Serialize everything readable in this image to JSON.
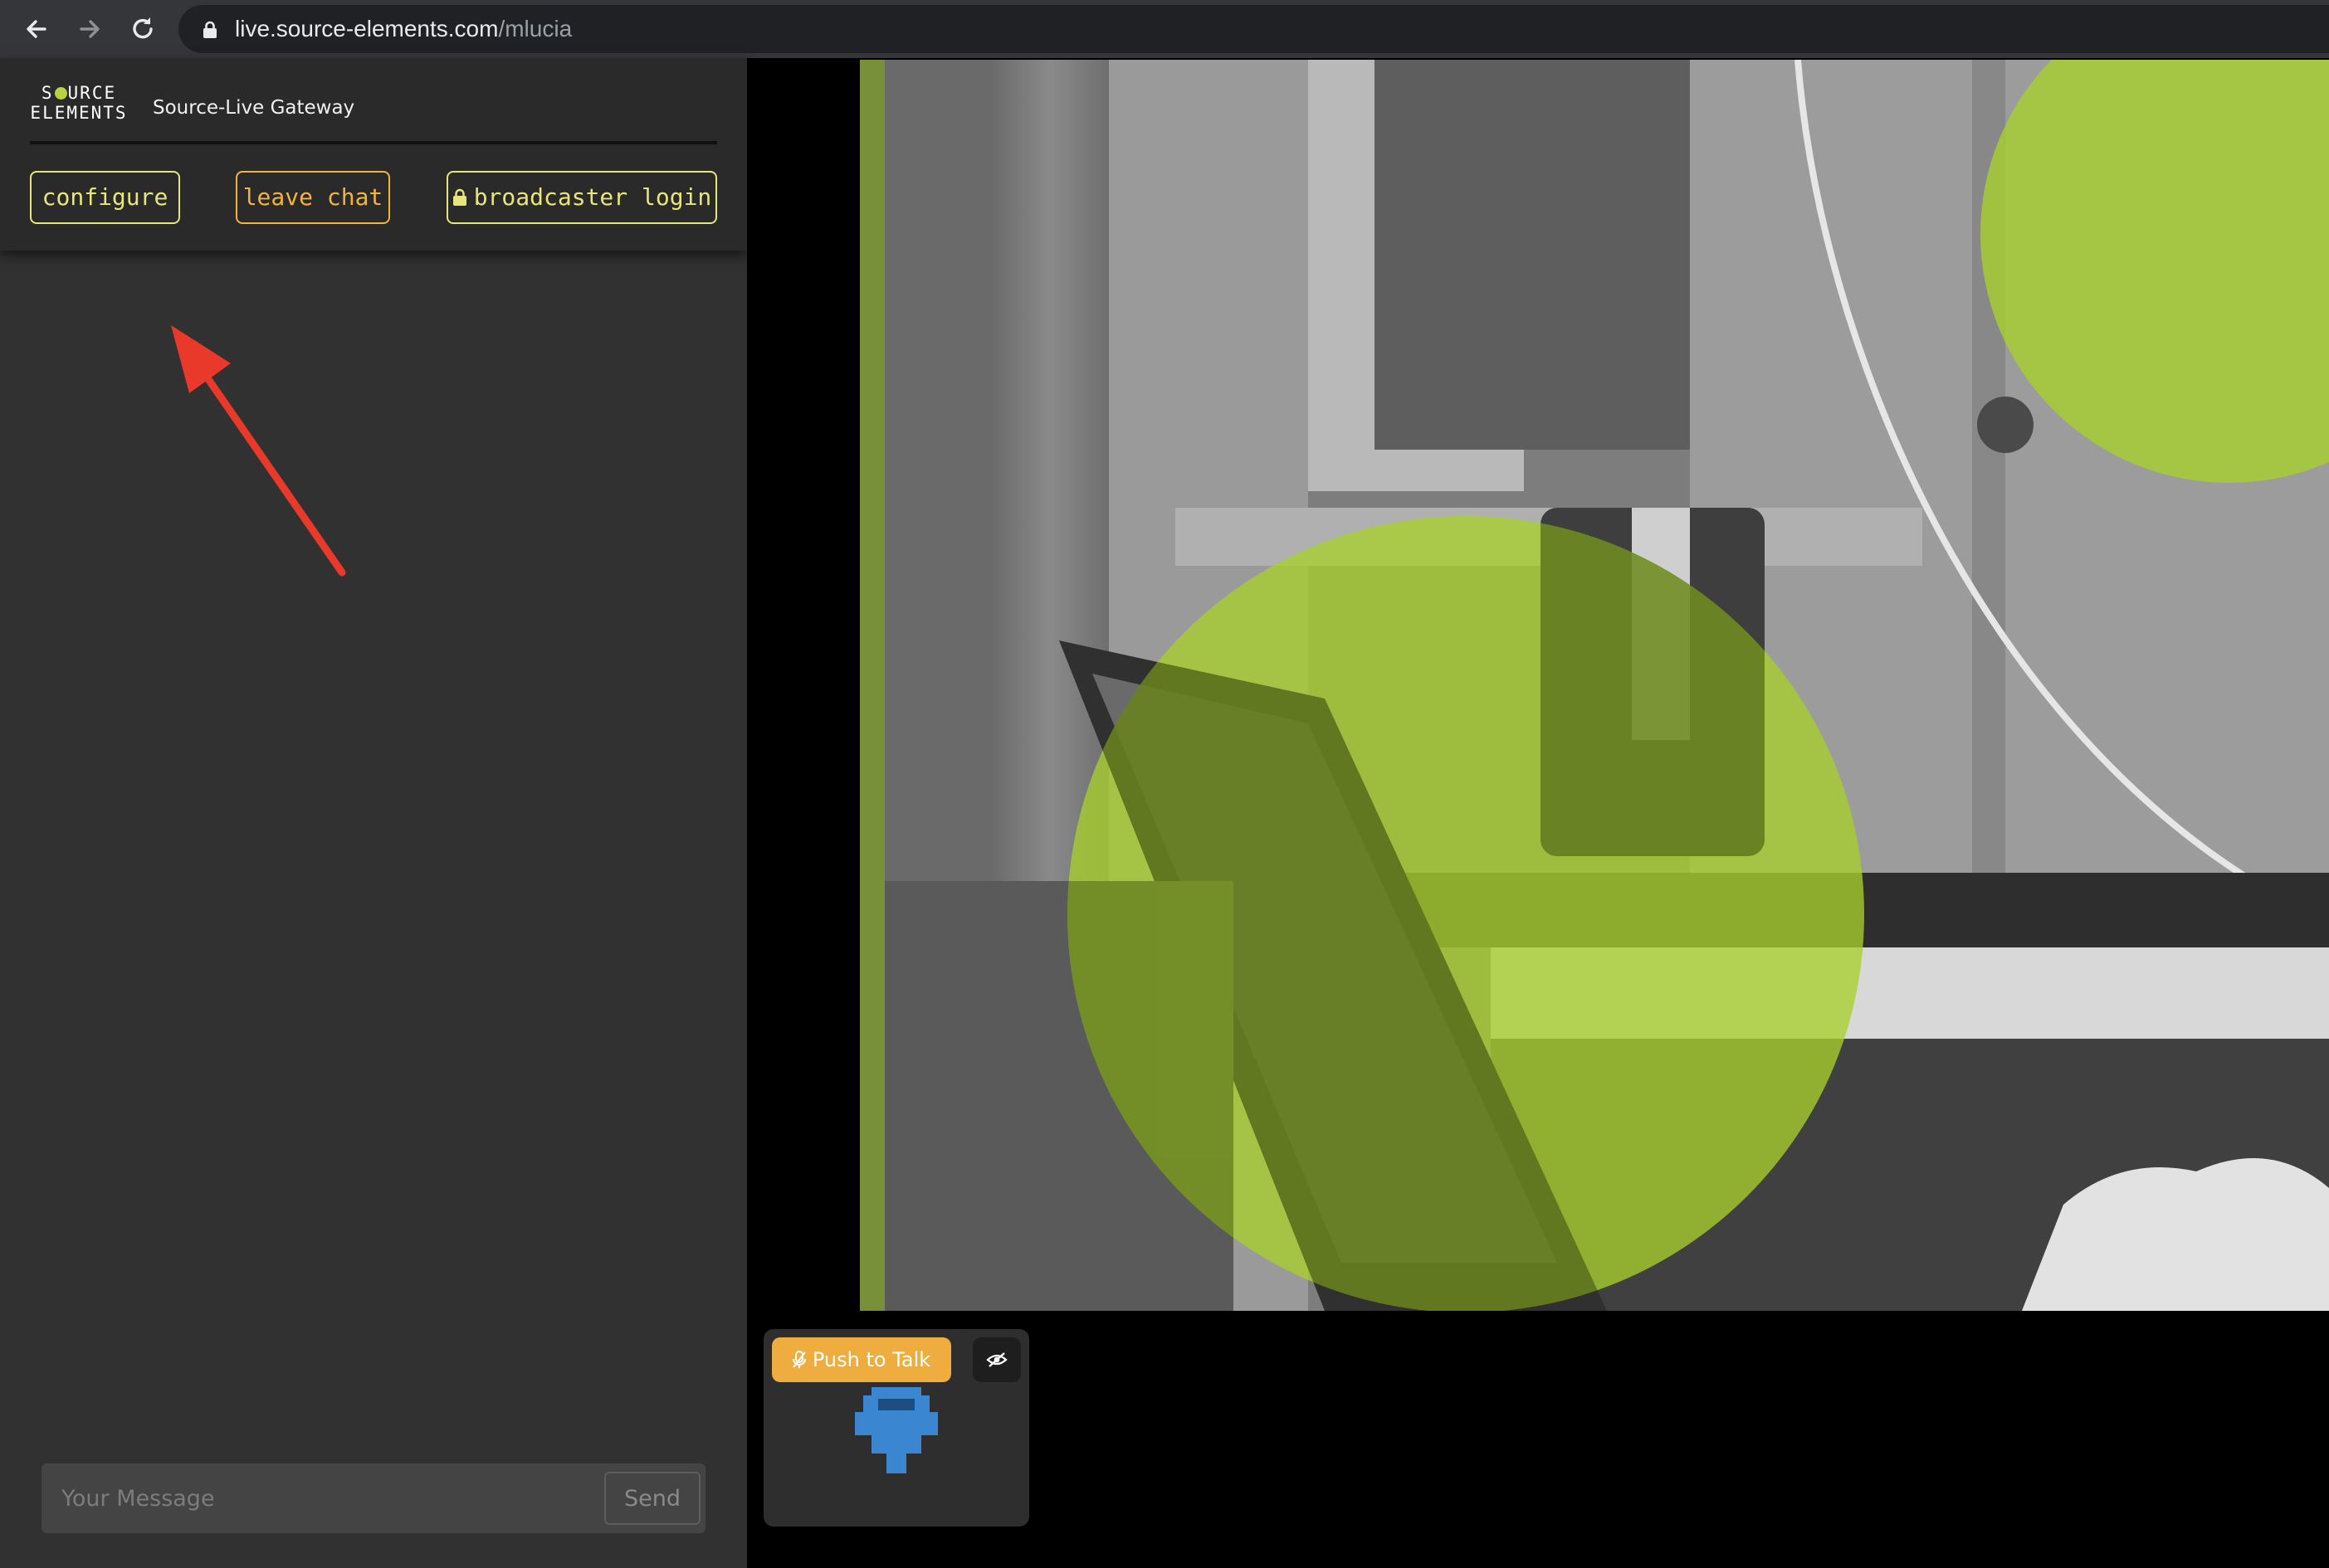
{
  "browser": {
    "url_host": "live.source-elements.com",
    "url_path": "/mlucia",
    "icons": [
      "back-arrow-icon",
      "forward-arrow-icon",
      "reload-icon",
      "lock-icon"
    ]
  },
  "sidebar": {
    "logo_line1": "S",
    "logo_line1b": "URCE",
    "logo_line2": "ELEMENTS",
    "title": "Source-Live Gateway",
    "buttons": {
      "configure": "configure",
      "leave_chat": "leave chat",
      "broadcaster_login": "broadcaster login"
    },
    "colors": {
      "accent_yellow": "#e8e67a",
      "accent_orange": "#f2b340",
      "logo_dot": "#b5d43f"
    }
  },
  "chat": {
    "message_placeholder": "Your Message",
    "send_label": "Send"
  },
  "controls": {
    "push_to_talk_label": "Push to Talk",
    "push_to_talk_color": "#f0ad3f",
    "icons": [
      "microphone-icon",
      "eye-slash-icon",
      "pixel-avatar-icon"
    ]
  },
  "annotation": {
    "arrow_color": "#e8392a"
  }
}
